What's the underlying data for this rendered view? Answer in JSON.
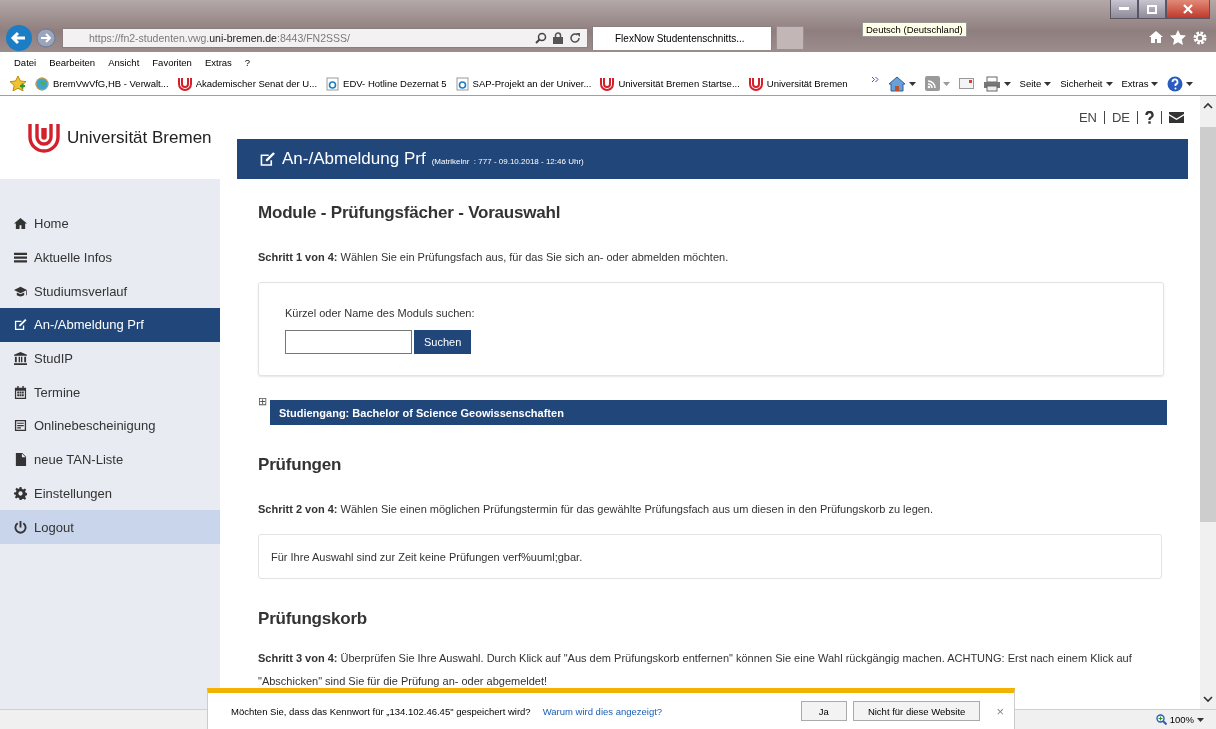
{
  "browser": {
    "address": "https://fn2-studenten.vwg.**uni-bremen.de**:8443/FN2SSS/",
    "tab": {
      "label": "FlexNow Studentenschnitts...",
      "selected": true
    },
    "tooltip": "Deutsch (Deutschland)",
    "menu": [
      "Datei",
      "Bearbeiten",
      "Ansicht",
      "Favoriten",
      "Extras",
      "?"
    ],
    "favorites": [
      {
        "kind": "globe",
        "label": "BremVwVfG,HB - Verwalt..."
      },
      {
        "kind": "uni",
        "label": "Akademischer Senat der U..."
      },
      {
        "kind": "page",
        "label": "EDV- Hotline Dezernat 5"
      },
      {
        "kind": "page",
        "label": "SAP-Projekt an der Univer..."
      },
      {
        "kind": "uni",
        "label": "Universität Bremen Startse..."
      },
      {
        "kind": "uni",
        "label": "Universität Bremen"
      }
    ],
    "tools": [
      "Seite",
      "Sicherheit",
      "Extras"
    ]
  },
  "page": {
    "logo": "Universität Bremen",
    "languages": [
      "EN",
      "DE"
    ],
    "header": {
      "title": "An-/Abmeldung Prf",
      "subtitle": "(Matrikelnr  : 777 - 09.10.2018 - 12:46 Uhr)"
    },
    "nav": [
      {
        "kind": "home",
        "label": "Home",
        "selected": false
      },
      {
        "kind": "infos",
        "label": "Aktuelle Infos",
        "selected": false
      },
      {
        "kind": "course",
        "label": "Studiumsverlauf",
        "selected": false
      },
      {
        "kind": "registration",
        "label": "An-/Abmeldung Prf",
        "selected": true
      },
      {
        "kind": "studip",
        "label": "StudIP",
        "selected": false
      },
      {
        "kind": "dates",
        "label": "Termine",
        "selected": false
      },
      {
        "kind": "certificate",
        "label": "Onlinebescheinigung",
        "selected": false
      },
      {
        "kind": "tan",
        "label": "neue TAN-Liste",
        "selected": false
      },
      {
        "kind": "settings",
        "label": "Einstellungen",
        "selected": false
      },
      {
        "kind": "logout",
        "label": "Logout",
        "selected": false
      }
    ],
    "module": {
      "heading": "Module - Prüfungsfächer - Vorauswahl",
      "step": "**Schritt 1 von 4:** Wählen Sie ein Prüfungsfach aus, für das Sie sich an- oder abmelden möchten.",
      "search_label": "Kürzel oder Name des Moduls suchen:",
      "search_button": "Suchen",
      "expander": "⊞",
      "expanded": false,
      "program": "Studiengang: Bachelor of Science Geowissenschaften"
    },
    "exams": {
      "heading": "Prüfungen",
      "step": "**Schritt 2 von 4:** Wählen Sie einen möglichen Prüfungstermin für das gewählte Prüfungsfach aus um diesen in den Prüfungskorb zu legen.",
      "message": "Für Ihre Auswahl sind zur Zeit keine Prüfungen verf%uuml;gbar."
    },
    "basket": {
      "heading": "Prüfungskorb",
      "step": "**Schritt 3 von 4:** Überprüfen Sie Ihre Auswahl. Durch Klick auf \"Aus dem Prüfungskorb entfernen\" können Sie eine Wahl rückgängig machen. ACHTUNG: Erst nach einem Klick auf \"Abschicken\" sind Sie für die Prüfung an- oder abgemeldet!"
    }
  },
  "notification": {
    "text": "Möchten Sie, dass das Kennwort für „134.102.46.45\" gespeichert wird?",
    "link": "Warum wird dies angezeigt?",
    "buttons": [
      "Ja",
      "Nicht für diese Website"
    ],
    "close": "×"
  },
  "status_bar": {
    "zoom": "100%"
  }
}
